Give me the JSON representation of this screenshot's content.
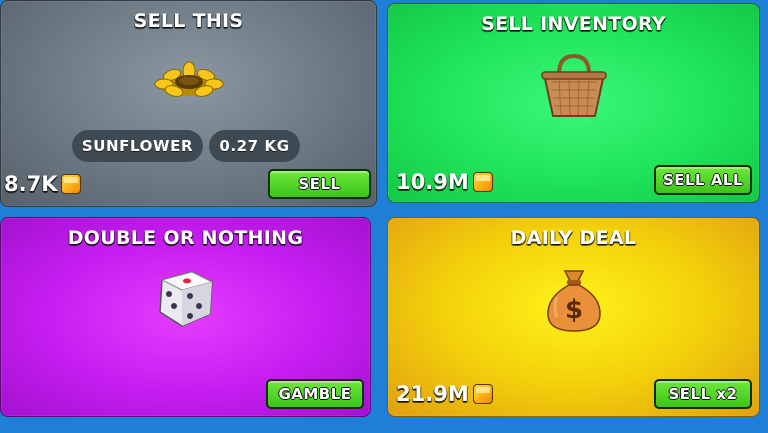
{
  "sell_this": {
    "title": "SELL THIS",
    "item_name": "SUNFLOWER",
    "item_weight": "0.27 KG",
    "value": "8.7K",
    "button": "SELL",
    "item_icon": "sunflower-icon"
  },
  "sell_inventory": {
    "title": "SELL INVENTORY",
    "value": "10.9M",
    "button": "SELL ALL",
    "item_icon": "basket-icon"
  },
  "double_or_nothing": {
    "title": "DOUBLE OR NOTHING",
    "button": "GAMBLE",
    "item_icon": "dice-icon"
  },
  "daily_deal": {
    "title": "DAILY DEAL",
    "value": "21.9M",
    "button": "SELL x2",
    "item_icon": "money-bag-icon"
  },
  "colors": {
    "sell_this_bg": "#6f7d88",
    "sell_inventory_bg": "#1ee55a",
    "double_or_nothing_bg": "#c51df0",
    "daily_deal_bg": "#f3d10a",
    "button_green": "#4fd427",
    "page_bg": "#1f7fd6"
  }
}
